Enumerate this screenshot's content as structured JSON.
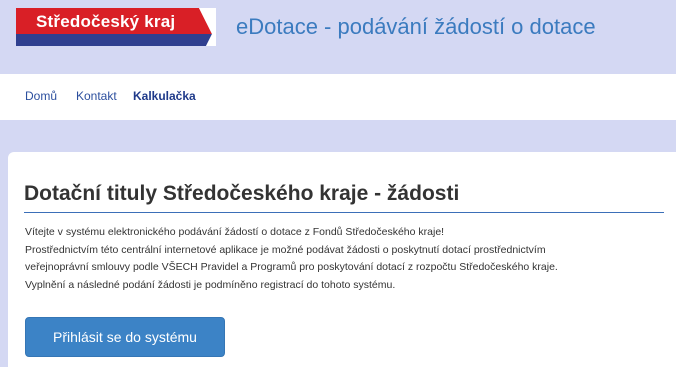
{
  "header": {
    "logo_text": "Středočeský kraj",
    "app_title": "eDotace - podávání žádostí o dotace",
    "logo_colors": {
      "red": "#d91f26",
      "blue": "#2f3f8f"
    }
  },
  "nav": {
    "items": [
      {
        "label": "Domů"
      },
      {
        "label": "Kontakt"
      },
      {
        "label": "Kalkulačka"
      }
    ]
  },
  "main": {
    "title": "Dotační tituly Středočeského kraje - žádosti",
    "intro_lines": [
      "Vítejte v systému elektronického podávání žádostí o dotace z Fondů Středočeského kraje!",
      "Prostřednictvím této centrální internetové aplikace je možné podávat žádosti o poskytnutí dotací prostřednictvím",
      "veřejnoprávní smlouvy podle VŠECH Pravidel a Programů pro poskytování dotací z rozpočtu Středočeského kraje.",
      "Vyplnění a následné podání žádosti je podmíněno registrací do tohoto systému."
    ],
    "login_button": "Přihlásit se do systému"
  },
  "colors": {
    "background": "#d4d8f3",
    "accent": "#3c83c6",
    "title_blue": "#3b7bbf"
  }
}
